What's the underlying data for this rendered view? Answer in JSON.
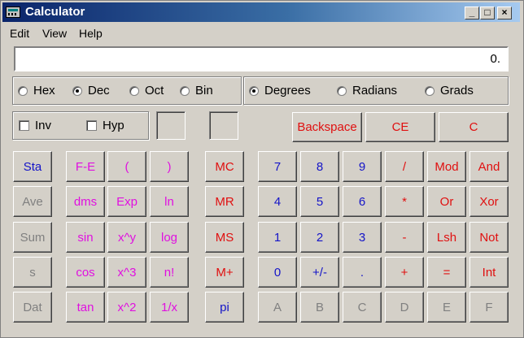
{
  "title": "Calculator",
  "window_controls": {
    "minimize": "_",
    "maximize": "□",
    "close": "×"
  },
  "menu": [
    "Edit",
    "View",
    "Help"
  ],
  "display_value": "0.",
  "base_radios": [
    {
      "label": "Hex",
      "checked": false
    },
    {
      "label": "Dec",
      "checked": true
    },
    {
      "label": "Oct",
      "checked": false
    },
    {
      "label": "Bin",
      "checked": false
    }
  ],
  "angle_radios": [
    {
      "label": "Degrees",
      "checked": true
    },
    {
      "label": "Radians",
      "checked": false
    },
    {
      "label": "Grads",
      "checked": false
    }
  ],
  "checkboxes": [
    {
      "label": "Inv",
      "checked": false
    },
    {
      "label": "Hyp",
      "checked": false
    }
  ],
  "edit_buttons": [
    "Backspace",
    "CE",
    "C"
  ],
  "stat_buttons": [
    {
      "label": "Sta",
      "enabled": true
    },
    {
      "label": "Ave",
      "enabled": false
    },
    {
      "label": "Sum",
      "enabled": false
    },
    {
      "label": "s",
      "enabled": false
    },
    {
      "label": "Dat",
      "enabled": false
    }
  ],
  "function_rows": [
    [
      "F-E",
      "(",
      ")"
    ],
    [
      "dms",
      "Exp",
      "ln"
    ],
    [
      "sin",
      "x^y",
      "log"
    ],
    [
      "cos",
      "x^3",
      "n!"
    ],
    [
      "tan",
      "x^2",
      "1/x"
    ]
  ],
  "memory_buttons": [
    {
      "label": "MC",
      "color": "red"
    },
    {
      "label": "MR",
      "color": "red"
    },
    {
      "label": "MS",
      "color": "red"
    },
    {
      "label": "M+",
      "color": "red"
    },
    {
      "label": "pi",
      "color": "blue"
    }
  ],
  "keypad_rows": [
    [
      {
        "label": "7",
        "color": "blue"
      },
      {
        "label": "8",
        "color": "blue"
      },
      {
        "label": "9",
        "color": "blue"
      },
      {
        "label": "/",
        "color": "red"
      },
      {
        "label": "Mod",
        "color": "red"
      },
      {
        "label": "And",
        "color": "red"
      }
    ],
    [
      {
        "label": "4",
        "color": "blue"
      },
      {
        "label": "5",
        "color": "blue"
      },
      {
        "label": "6",
        "color": "blue"
      },
      {
        "label": "*",
        "color": "red"
      },
      {
        "label": "Or",
        "color": "red"
      },
      {
        "label": "Xor",
        "color": "red"
      }
    ],
    [
      {
        "label": "1",
        "color": "blue"
      },
      {
        "label": "2",
        "color": "blue"
      },
      {
        "label": "3",
        "color": "blue"
      },
      {
        "label": "-",
        "color": "red"
      },
      {
        "label": "Lsh",
        "color": "red"
      },
      {
        "label": "Not",
        "color": "red"
      }
    ],
    [
      {
        "label": "0",
        "color": "blue"
      },
      {
        "label": "+/-",
        "color": "blue"
      },
      {
        "label": ".",
        "color": "blue"
      },
      {
        "label": "+",
        "color": "red"
      },
      {
        "label": "=",
        "color": "red"
      },
      {
        "label": "Int",
        "color": "red"
      }
    ],
    [
      {
        "label": "A",
        "color": "gray"
      },
      {
        "label": "B",
        "color": "gray"
      },
      {
        "label": "C",
        "color": "gray"
      },
      {
        "label": "D",
        "color": "gray"
      },
      {
        "label": "E",
        "color": "gray"
      },
      {
        "label": "F",
        "color": "gray"
      }
    ]
  ]
}
